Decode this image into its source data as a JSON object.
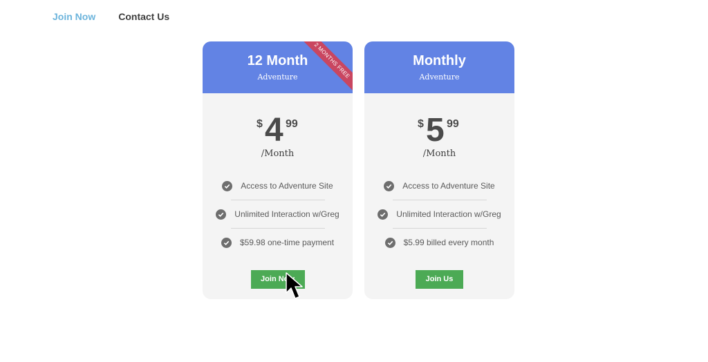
{
  "nav": {
    "join_now": "Join Now",
    "contact_us": "Contact Us"
  },
  "plans": [
    {
      "title": "12 Month",
      "subtitle": "Adventure",
      "ribbon": "2 MONTHS FREE",
      "currency": "$",
      "price_whole": "4",
      "price_cents": "99",
      "period": "/Month",
      "features": [
        "Access to Adventure Site",
        "Unlimited Interaction w/Greg",
        "$59.98 one-time payment"
      ],
      "button": "Join Now"
    },
    {
      "title": "Monthly",
      "subtitle": "Adventure",
      "currency": "$",
      "price_whole": "5",
      "price_cents": "99",
      "period": "/Month",
      "features": [
        "Access to Adventure Site",
        "Unlimited Interaction w/Greg",
        "$5.99 billed every month"
      ],
      "button": "Join Us"
    }
  ],
  "colors": {
    "header": "#6283e4",
    "button": "#4caa55",
    "ribbon": "#c94660",
    "nav_active": "#6cb4dc"
  }
}
